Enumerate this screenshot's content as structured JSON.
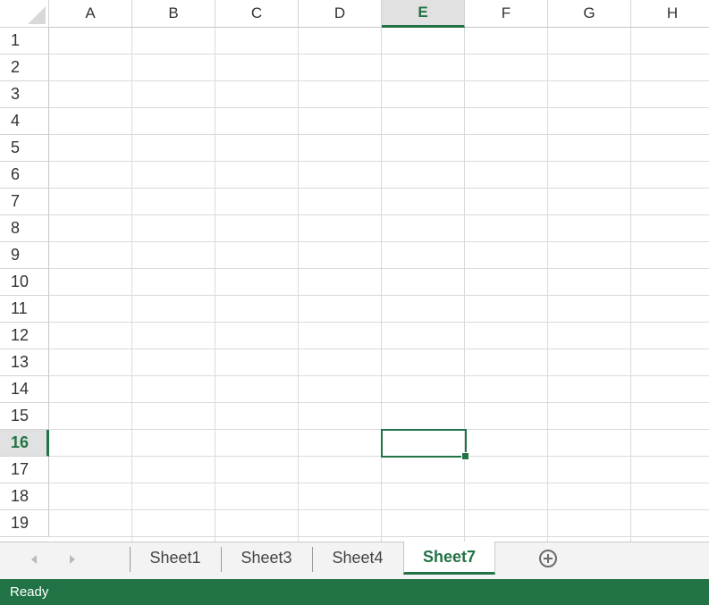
{
  "grid": {
    "columns": [
      "A",
      "B",
      "C",
      "D",
      "E",
      "F",
      "G",
      "H"
    ],
    "rows": [
      "1",
      "2",
      "3",
      "4",
      "5",
      "6",
      "7",
      "8",
      "9",
      "10",
      "11",
      "12",
      "13",
      "14",
      "15",
      "16",
      "17",
      "18",
      "19"
    ],
    "active_column": "E",
    "active_row": "16"
  },
  "sheet_tabs": {
    "tabs": [
      "Sheet1",
      "Sheet3",
      "Sheet4",
      "Sheet7"
    ],
    "active": "Sheet7"
  },
  "icons": {
    "corner": "select-all-icon",
    "nav_left": "scroll-left-icon",
    "nav_right": "scroll-right-icon",
    "add_sheet": "plus-circle-icon"
  },
  "colors": {
    "accent": "#217346",
    "gridline": "#dadada",
    "header_active_bg": "#e1e1e1"
  },
  "status_bar": {
    "text": "Ready"
  }
}
